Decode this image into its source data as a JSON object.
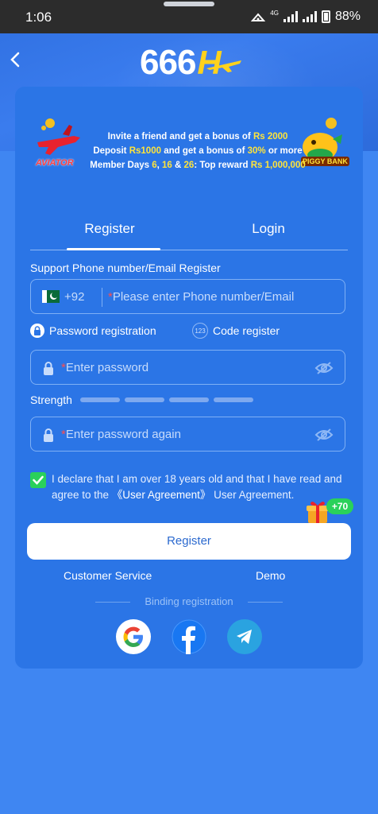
{
  "status": {
    "time": "1:06",
    "network": "4G",
    "battery": "88%"
  },
  "brand": {
    "logo_digits": "666",
    "logo_letter": "H"
  },
  "promo": {
    "line1_prefix": "Invite a friend and get a bonus of ",
    "line1_amount": "Rs 2000",
    "line2_prefix": "Deposit ",
    "line2_amount": "Rs1000",
    "line2_mid": " and get a bonus of ",
    "line2_percent": "30%",
    "line2_suffix": " or more",
    "line3_prefix": "Member Days ",
    "line3_d1": "6",
    "line3_sep1": ", ",
    "line3_d2": "16",
    "line3_sep2": " & ",
    "line3_d3": "26",
    "line3_mid": ": Top reward ",
    "line3_reward": "Rs 1,000,000",
    "aviator_label": "AVIATOR",
    "piggy_label": "PIGGY BANK"
  },
  "tabs": {
    "register": "Register",
    "login": "Login"
  },
  "form": {
    "support_label": "Support Phone number/Email Register",
    "country_code": "+92",
    "phone_placeholder": "Please enter Phone number/Email",
    "option_password": "Password registration",
    "option_code": "Code register",
    "code_icon_text": "123",
    "password_placeholder": "Enter password",
    "strength_label": "Strength",
    "strength_level": 0,
    "confirm_placeholder": "Enter password again",
    "required_mark": "*",
    "declaration_text": "I declare that I am over 18 years old and that I have read and agree to the ",
    "agreement_link": "《User Agreement》",
    "declaration_suffix": " User Agreement.",
    "agreement_checked": true,
    "register_button": "Register",
    "bonus_badge": "+70"
  },
  "links": {
    "customer_service": "Customer Service",
    "demo": "Demo"
  },
  "binding": {
    "title": "Binding registration"
  },
  "colors": {
    "background": "#3f86f2",
    "card": "#2b75e6",
    "accent_yellow": "#ffe43b",
    "check_green": "#2ad15a"
  }
}
